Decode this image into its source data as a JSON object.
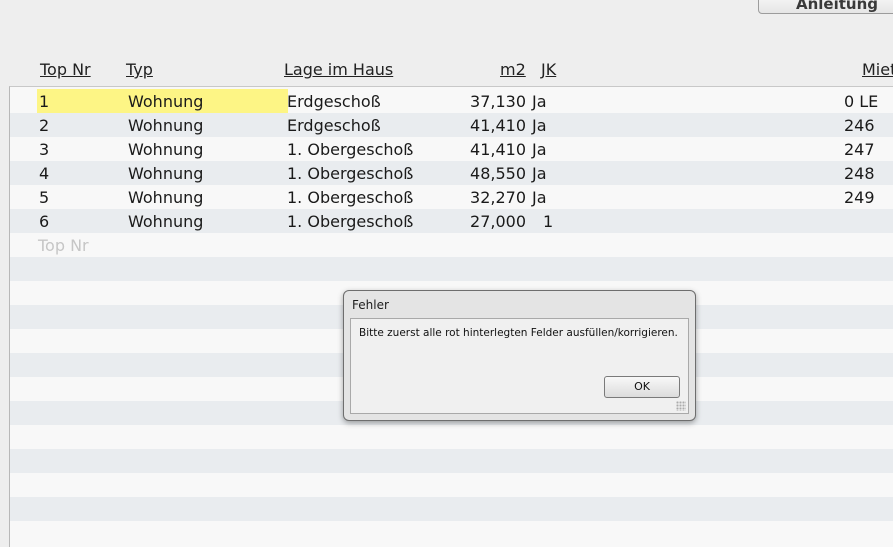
{
  "toolbar": {
    "manual_button_label": "Anleitung"
  },
  "table": {
    "columns": {
      "top_nr": "Top Nr",
      "typ": "Typ",
      "lage": "Lage im Haus",
      "m2": "m2",
      "jk": "JK",
      "miete": "Miet"
    },
    "rows": [
      {
        "top_nr": "1",
        "typ": "Wohnung",
        "lage": "Erdgeschoß",
        "m2": "37,130",
        "jk": "Ja",
        "miete": "0 LE"
      },
      {
        "top_nr": "2",
        "typ": "Wohnung",
        "lage": "Erdgeschoß",
        "m2": "41,410",
        "jk": "Ja",
        "miete": "246"
      },
      {
        "top_nr": "3",
        "typ": "Wohnung",
        "lage": "1. Obergeschoß",
        "m2": "41,410",
        "jk": "Ja",
        "miete": "247"
      },
      {
        "top_nr": "4",
        "typ": "Wohnung",
        "lage": "1. Obergeschoß",
        "m2": "48,550",
        "jk": "Ja",
        "miete": "248"
      },
      {
        "top_nr": "5",
        "typ": "Wohnung",
        "lage": "1. Obergeschoß",
        "m2": "32,270",
        "jk": "Ja",
        "miete": "249"
      },
      {
        "top_nr": "6",
        "typ": "Wohnung",
        "lage": "1. Obergeschoß",
        "m2": "27,000",
        "jk": "1",
        "miete": ""
      }
    ],
    "new_row_placeholder": "Top Nr",
    "highlight_color": "#fdf585"
  },
  "dialog": {
    "title": "Fehler",
    "message": "Bitte zuerst alle rot hinterlegten Felder ausfüllen/korrigieren.",
    "ok_label": "OK"
  }
}
